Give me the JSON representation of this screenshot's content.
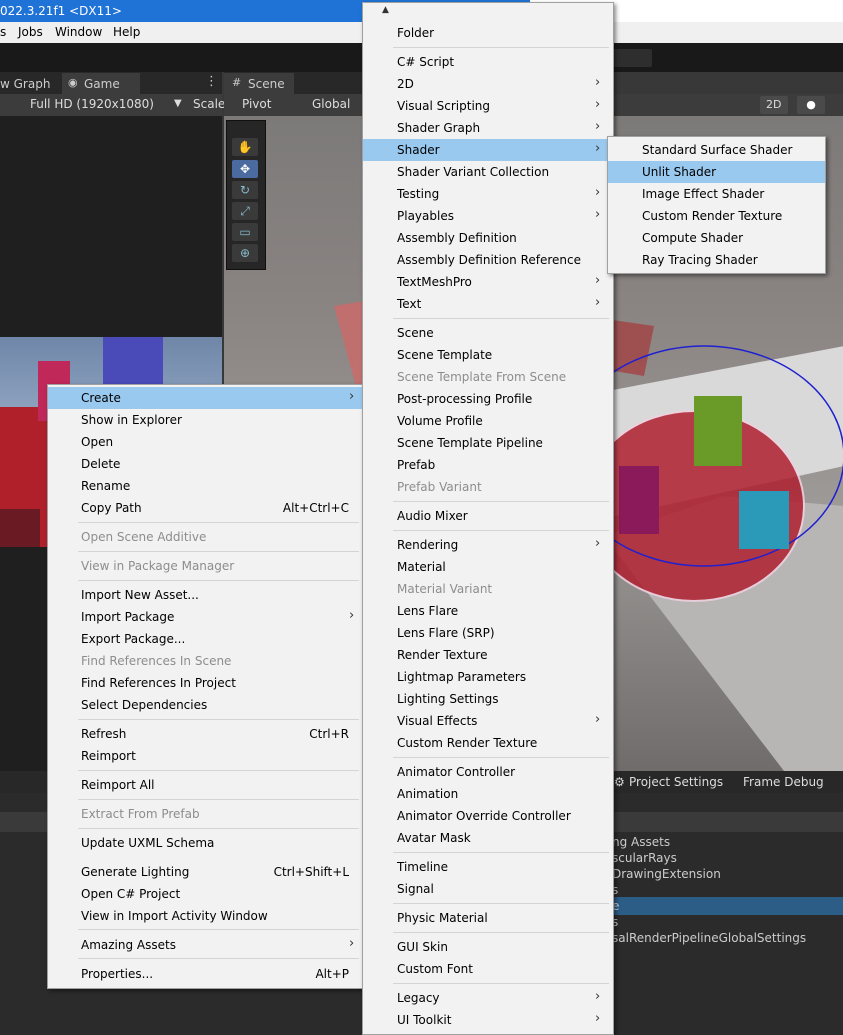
{
  "title_bar": {
    "text": "022.3.21f1 <DX11>"
  },
  "menubar": {
    "items": [
      "s",
      "Jobs",
      "Window",
      "Help"
    ]
  },
  "panel_tabs": {
    "graph": "w Graph",
    "game": "Game",
    "scene": "Scene"
  },
  "game_controls": {
    "resolution": "Full HD (1920x1080)",
    "scale": "Scale"
  },
  "scene_controls": {
    "pivot": "Pivot",
    "global": "Global",
    "mode_2d": "2D"
  },
  "bottom_tabs": {
    "project_settings": "Project Settings",
    "frame_debug": "Frame Debug"
  },
  "project_list": [
    "ng Assets",
    "scularRays",
    "DrawingExtension",
    "s",
    "e",
    "s",
    "salRenderPipelineGlobalSettings"
  ],
  "context_menu": {
    "items": [
      {
        "label": "Create",
        "arrow": true,
        "highlight": true
      },
      {
        "label": "Show in Explorer"
      },
      {
        "label": "Open"
      },
      {
        "label": "Delete"
      },
      {
        "label": "Rename"
      },
      {
        "label": "Copy Path",
        "shortcut": "Alt+Ctrl+C"
      },
      {
        "label": "Open Scene Additive",
        "disabled": true
      },
      {
        "label": "View in Package Manager",
        "disabled": true
      },
      {
        "label": "Import New Asset..."
      },
      {
        "label": "Import Package",
        "arrow": true
      },
      {
        "label": "Export Package..."
      },
      {
        "label": "Find References In Scene",
        "disabled": true
      },
      {
        "label": "Find References In Project"
      },
      {
        "label": "Select Dependencies"
      },
      {
        "label": "Refresh",
        "shortcut": "Ctrl+R"
      },
      {
        "label": "Reimport"
      },
      {
        "label": "Reimport All"
      },
      {
        "label": "Extract From Prefab",
        "disabled": true
      },
      {
        "label": "Update UXML Schema"
      },
      {
        "label": "Generate Lighting",
        "shortcut": "Ctrl+Shift+L"
      },
      {
        "label": "Open C# Project"
      },
      {
        "label": "View in Import Activity Window"
      },
      {
        "label": "Amazing Assets",
        "arrow": true
      },
      {
        "label": "Properties...",
        "shortcut": "Alt+P"
      }
    ]
  },
  "create_menu": {
    "items": [
      {
        "label": "Folder"
      },
      {
        "label": "C# Script"
      },
      {
        "label": "2D",
        "arrow": true
      },
      {
        "label": "Visual Scripting",
        "arrow": true
      },
      {
        "label": "Shader Graph",
        "arrow": true
      },
      {
        "label": "Shader",
        "arrow": true,
        "highlight": true
      },
      {
        "label": "Shader Variant Collection"
      },
      {
        "label": "Testing",
        "arrow": true
      },
      {
        "label": "Playables",
        "arrow": true
      },
      {
        "label": "Assembly Definition"
      },
      {
        "label": "Assembly Definition Reference"
      },
      {
        "label": "TextMeshPro",
        "arrow": true
      },
      {
        "label": "Text",
        "arrow": true
      },
      {
        "label": "Scene"
      },
      {
        "label": "Scene Template"
      },
      {
        "label": "Scene Template From Scene",
        "disabled": true
      },
      {
        "label": "Post-processing Profile"
      },
      {
        "label": "Volume Profile"
      },
      {
        "label": "Scene Template Pipeline"
      },
      {
        "label": "Prefab"
      },
      {
        "label": "Prefab Variant",
        "disabled": true
      },
      {
        "label": "Audio Mixer"
      },
      {
        "label": "Rendering",
        "arrow": true
      },
      {
        "label": "Material"
      },
      {
        "label": "Material Variant",
        "disabled": true
      },
      {
        "label": "Lens Flare"
      },
      {
        "label": "Lens Flare (SRP)"
      },
      {
        "label": "Render Texture"
      },
      {
        "label": "Lightmap Parameters"
      },
      {
        "label": "Lighting Settings"
      },
      {
        "label": "Visual Effects",
        "arrow": true
      },
      {
        "label": "Custom Render Texture"
      },
      {
        "label": "Animator Controller"
      },
      {
        "label": "Animation"
      },
      {
        "label": "Animator Override Controller"
      },
      {
        "label": "Avatar Mask"
      },
      {
        "label": "Timeline"
      },
      {
        "label": "Signal"
      },
      {
        "label": "Physic Material"
      },
      {
        "label": "GUI Skin"
      },
      {
        "label": "Custom Font"
      },
      {
        "label": "Legacy",
        "arrow": true
      },
      {
        "label": "UI Toolkit",
        "arrow": true
      }
    ]
  },
  "shader_menu": {
    "items": [
      {
        "label": "Standard Surface Shader"
      },
      {
        "label": "Unlit Shader",
        "highlight": true
      },
      {
        "label": "Image Effect Shader"
      },
      {
        "label": "Custom Render Texture"
      },
      {
        "label": "Compute Shader"
      },
      {
        "label": "Ray Tracing Shader"
      }
    ]
  },
  "glyphs": {
    "arrow": "›",
    "scroll_up": "▲"
  },
  "colors": {
    "highlight": "#99c9ef",
    "title_bar": "#1f72d6",
    "disabled_text": "#8d8d8d"
  }
}
